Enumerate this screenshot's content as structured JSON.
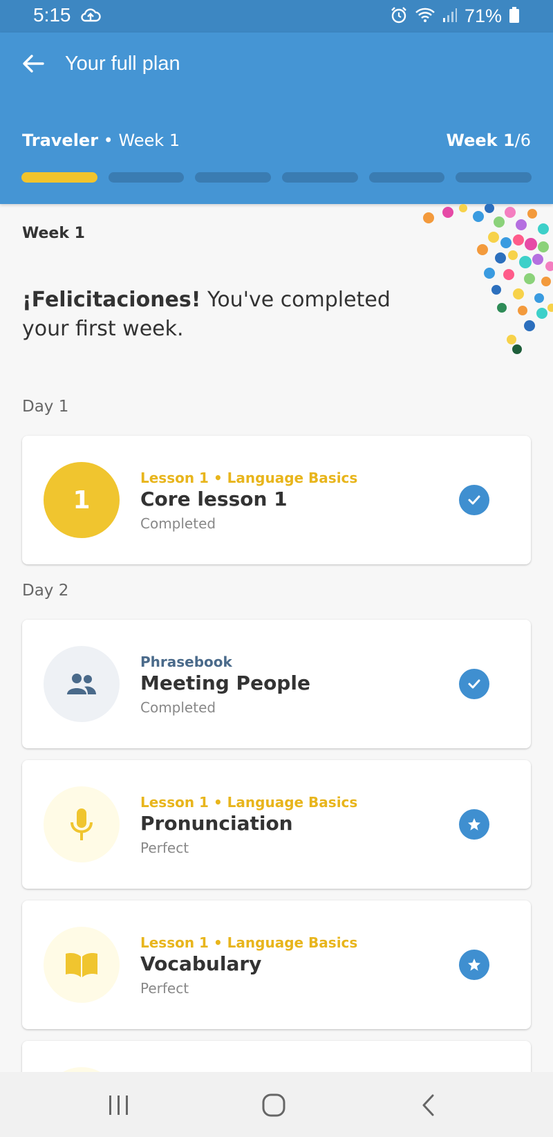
{
  "status_bar": {
    "time": "5:15",
    "battery": "71%"
  },
  "header": {
    "title": "Your full plan",
    "plan_name": "Traveler",
    "plan_week": " • Week 1",
    "week_current": "Week 1",
    "week_total": "/6",
    "progress": {
      "segments": 6,
      "completed": 1
    }
  },
  "main": {
    "week_heading": "Week 1",
    "congrats_bold": "¡Felicitaciones!",
    "congrats_text": " You've completed your first week.",
    "days": [
      {
        "label": "Day 1"
      },
      {
        "label": "Day 2"
      }
    ],
    "cards": [
      {
        "icon": "number-badge",
        "icon_text": "1",
        "eyebrow": "Lesson 1 • Language Basics",
        "title": "Core lesson 1",
        "status": "Completed",
        "badge": "check-icon"
      },
      {
        "icon": "people-icon",
        "eyebrow": "Phrasebook",
        "title": "Meeting People",
        "status": "Completed",
        "badge": "check-icon"
      },
      {
        "icon": "microphone-icon",
        "eyebrow": "Lesson 1 • Language Basics",
        "title": "Pronunciation",
        "status": "Perfect",
        "badge": "star-icon"
      },
      {
        "icon": "book-icon",
        "eyebrow": "Lesson 1 • Language Basics",
        "title": "Vocabulary",
        "status": "Perfect",
        "badge": "star-icon"
      }
    ]
  },
  "colors": {
    "app_bar": "#4595d4",
    "status_bar": "#3d87c2",
    "progress_done": "#f2c42c",
    "badge": "#3f8fd0",
    "eyebrow_gold": "#e8b51c"
  }
}
